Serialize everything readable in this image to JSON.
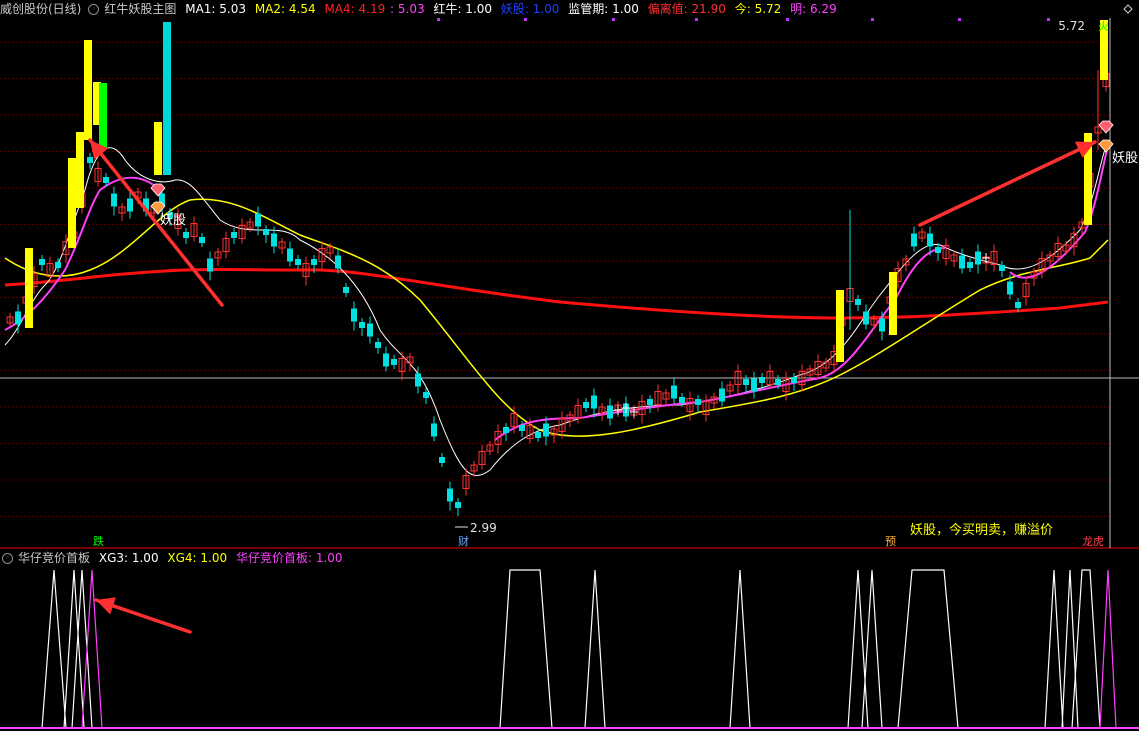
{
  "header": {
    "stock": "威创股份(日线)",
    "indicator": "红牛妖股主图",
    "ma1": {
      "label": "MA1: 5.03",
      "color": "#ffffff"
    },
    "ma2": {
      "label": "MA2: 4.54",
      "color": "#ffff00"
    },
    "ma4": {
      "label": "MA4: 4.19",
      "color": "#ff2020"
    },
    "ma4b": {
      "label": ": 5.03",
      "color": "#ff40ff"
    },
    "hongniu": {
      "label": "红牛: 1.00",
      "color": "#ffffff"
    },
    "yaogu": {
      "label": "妖股: 1.00",
      "color": "#2040ff"
    },
    "jianguan": {
      "label": "监管期: 1.00",
      "color": "#ffffff"
    },
    "pianli": {
      "label": "偏离值: 21.90",
      "color": "#ff3030"
    },
    "jin": {
      "label": "今: 5.72",
      "color": "#ffff00"
    },
    "ming": {
      "label": "明: 6.29",
      "color": "#ff40ff"
    }
  },
  "subpanel": {
    "title": "华仔竞价首板",
    "xg3": {
      "label": "XG3: 1.00",
      "color": "#ffffff"
    },
    "xg4": {
      "label": "XG4: 1.00",
      "color": "#ffff00"
    },
    "first": {
      "label": "华仔竞价首板: 1.00",
      "color": "#ff40ff"
    }
  },
  "annotations": {
    "price_high": "5.72",
    "price_low": "2.99",
    "yaogu1": "妖股",
    "yaogu2": "妖股",
    "die": "跌",
    "cai": "财",
    "yu": "预",
    "longhu": "龙虎",
    "huo": "火",
    "buy_msg": "妖股，今买明卖，赚溢价"
  },
  "colors": {
    "up": "#ff3232",
    "down": "#00e0e0",
    "yellow": "#ffff00",
    "ma_red": "#ff1010",
    "magenta": "#ff40ff",
    "grid": "#7a0000"
  }
}
